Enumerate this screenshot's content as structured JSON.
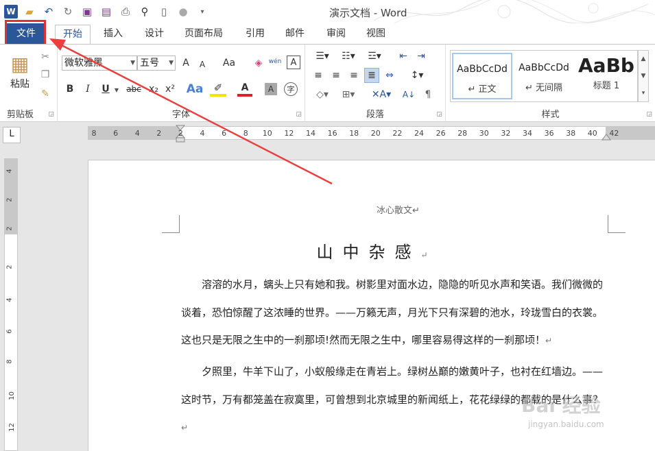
{
  "window": {
    "title": "演示文档 - Word"
  },
  "tabs": [
    {
      "label": "文件"
    },
    {
      "label": "开始"
    },
    {
      "label": "插入"
    },
    {
      "label": "设计"
    },
    {
      "label": "页面布局"
    },
    {
      "label": "引用"
    },
    {
      "label": "邮件"
    },
    {
      "label": "审阅"
    },
    {
      "label": "视图"
    }
  ],
  "ribbon": {
    "clipboard": {
      "label": "剪贴板",
      "paste": "粘贴"
    },
    "font": {
      "label": "字体",
      "font_name": "微软雅黑",
      "font_size": "五号",
      "bold": "B",
      "italic": "I",
      "underline": "U",
      "strike": "abc",
      "sub": "x₂",
      "sup": "x²",
      "case": "Aa",
      "grow": "A",
      "shrink": "A",
      "pinyin": "wén",
      "border": "A",
      "color": "A",
      "shade": "A",
      "enclose": "字"
    },
    "paragraph": {
      "label": "段落"
    },
    "styles": {
      "label": "样式",
      "items": [
        {
          "sample": "AaBbCcDd",
          "name": "↵ 正文"
        },
        {
          "sample": "AaBbCcDd",
          "name": "↵ 无间隔"
        },
        {
          "sample": "AaBb",
          "name": "标题 1"
        }
      ]
    }
  },
  "ruler": {
    "corner": "L",
    "h_ticks": [
      "8",
      "6",
      "4",
      "2",
      "2",
      "4",
      "6",
      "8",
      "10",
      "12",
      "14",
      "16",
      "18",
      "20",
      "22",
      "24",
      "26",
      "28",
      "30",
      "32",
      "34",
      "36",
      "38",
      "40",
      "42"
    ],
    "v_ticks": [
      "4",
      "2",
      "2",
      "2",
      "4",
      "6",
      "8",
      "10",
      "12"
    ]
  },
  "document": {
    "header": "冰心散文↵",
    "title": "山中杂感",
    "title_mark": "↵",
    "paragraphs": [
      "溶溶的水月，螭头上只有她和我。树影里对面水边，隐隐的听见水声和笑语。我们微微的谈着，恐怕惊醒了这浓睡的世界。——万籁无声，月光下只有深碧的池水，玲珑雪白的衣裳。这也只是无限之生中的一刹那顷!然而无限之生中，哪里容易得这样的一刹那顷！",
      "夕照里，牛羊下山了，小蚁般缘走在青岩上。绿树丛巅的嫩黄叶子，也衬在红墙边。——这时节，万有都笼盖在寂寞里，可曾想到北京城里的新闻纸上，花花绿绿的都载的是什么事？"
    ],
    "para_mark": "↵"
  },
  "watermark": {
    "main": "Bai 经验",
    "sub": "jingyan.baidu.com"
  },
  "colors": {
    "accent": "#2b579a",
    "highlight": "#e03030"
  }
}
